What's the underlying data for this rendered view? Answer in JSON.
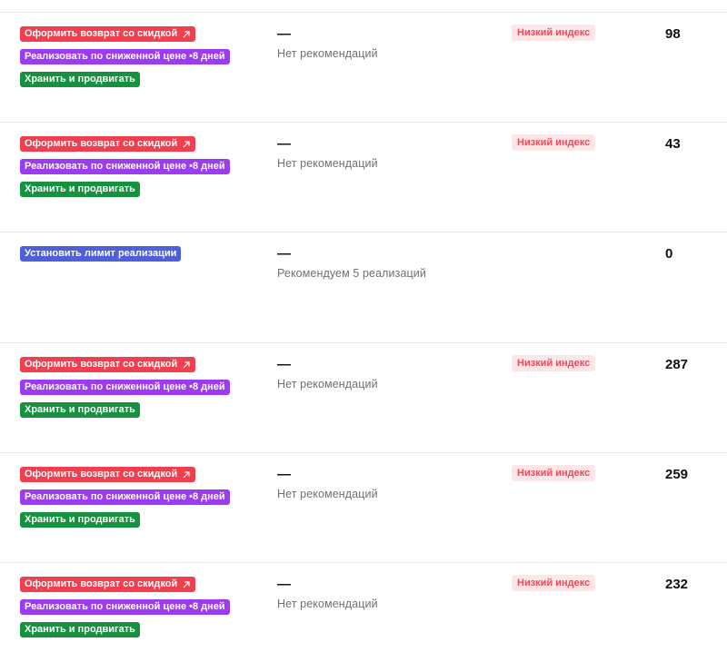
{
  "labels": {
    "return": "Оформить возврат со скидкой",
    "discount": "Реализовать по сниженной цене •8 дней",
    "store": "Хранить и продвигать",
    "limit": "Установить лимит реализации",
    "dash": "—",
    "no_rec": "Нет рекомендаций",
    "low_index": "Низкий индекс"
  },
  "rows": [
    {
      "actions": [
        "return",
        "discount",
        "store"
      ],
      "recommendation": "Нет рекомендаций",
      "index": "Низкий индекс",
      "count": "98"
    },
    {
      "actions": [
        "return",
        "discount",
        "store"
      ],
      "recommendation": "Нет рекомендаций",
      "index": "Низкий индекс",
      "count": "43"
    },
    {
      "actions": [
        "limit"
      ],
      "recommendation": "Рекомендуем 5 реализаций",
      "index": "",
      "count": "0"
    },
    {
      "actions": [
        "return",
        "discount",
        "store"
      ],
      "recommendation": "Нет рекомендаций",
      "index": "Низкий индекс",
      "count": "287"
    },
    {
      "actions": [
        "return",
        "discount",
        "store"
      ],
      "recommendation": "Нет рекомендаций",
      "index": "Низкий индекс",
      "count": "259"
    },
    {
      "actions": [
        "return",
        "discount",
        "store"
      ],
      "recommendation": "Нет рекомендаций",
      "index": "Низкий индекс",
      "count": "232"
    }
  ],
  "colors": {
    "return_tag": "#f0404f",
    "discount_tag": "#9b3cf0",
    "store_tag": "#17913f",
    "limit_tag": "#4e5fdb",
    "low_index_bg": "#fde6e8",
    "low_index_text": "#ea4a5a"
  },
  "icons": {
    "return_tag_icon": "external-arrow-icon"
  }
}
